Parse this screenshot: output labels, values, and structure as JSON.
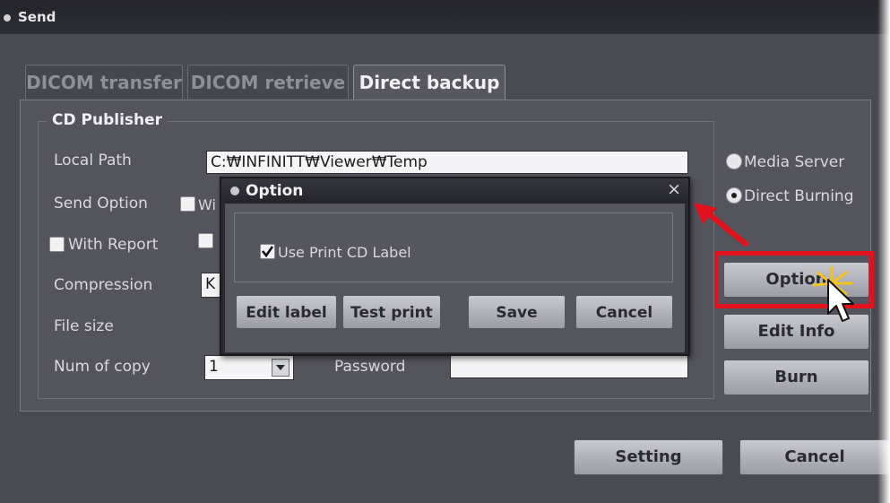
{
  "window": {
    "title": "Send"
  },
  "tabs": [
    {
      "label": "DICOM transfer"
    },
    {
      "label": "DICOM retrieve"
    },
    {
      "label": "Direct backup"
    }
  ],
  "publisher": {
    "group_title": "CD Publisher",
    "local_path_label": "Local Path",
    "local_path_value": "C:₩INFINITT₩Viewer₩Temp",
    "send_option_label": "Send Option",
    "send_option_check_partial": "Wi",
    "with_report_label": "With Report",
    "compression_label": "Compression",
    "compression_value_partial": "K",
    "file_size_label": "File size",
    "num_copy_label": "Num of copy",
    "num_copy_value": "1",
    "password_label": "Password",
    "password_value": ""
  },
  "right": {
    "media_server": "Media Server",
    "direct_burning": "Direct Burning",
    "option_button": "Option",
    "edit_info_button": "Edit Info",
    "burn_button": "Burn"
  },
  "bottom": {
    "setting_button": "Setting",
    "cancel_button": "Cancel"
  },
  "dialog": {
    "title": "Option",
    "close": "×",
    "use_print_label": "Use Print CD Label",
    "edit_label_button": "Edit label",
    "test_print_button": "Test print",
    "save_button": "Save",
    "cancel_button": "Cancel"
  },
  "colors": {
    "highlight_frame": "#e3111b",
    "arrow": "#e3111b",
    "cursor_burst": "#f4c21b"
  }
}
